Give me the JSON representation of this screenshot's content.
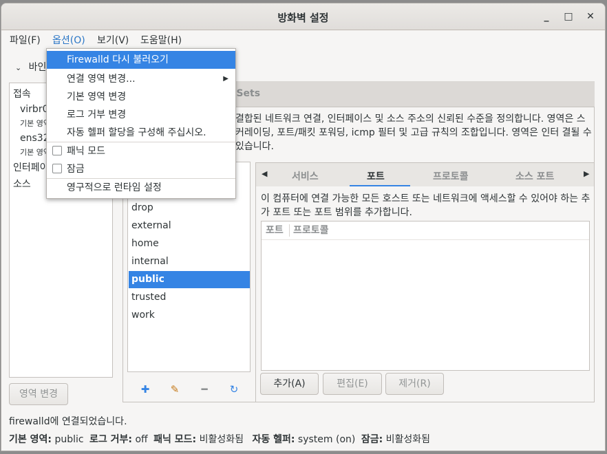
{
  "window": {
    "title": "방화벽 설정",
    "minimize": "_",
    "maximize": "□",
    "close": "✕"
  },
  "menubar": [
    "파일(F)",
    "옵션(O)",
    "보기(V)",
    "도움말(H)"
  ],
  "binding_label": "바인",
  "left_list": {
    "connections_header": "접속",
    "connections": [
      {
        "name": "virbr0",
        "zone": "기본 영역"
      },
      {
        "name": "ens32",
        "zone": "기본 영역"
      }
    ],
    "interfaces_header": "인터페이",
    "sources_header": "소스"
  },
  "change_zone_button": "영역 변경",
  "top_tab_partial": "IPSets",
  "zone_description": "결합된 네트워크 연결, 인터페이스 및 소스 주소의 신뢰된 수준을 정의합니다. 영역은 스커레이딩, 포트/패킷 포워딩, icmp 필터 및 고급 규칙의 조합입니다. 영역은 인터 결될 수 있습니다.",
  "zones": [
    "drop",
    "external",
    "home",
    "internal",
    "public",
    "trusted",
    "work"
  ],
  "selected_zone": "public",
  "subtabs": [
    "서비스",
    "포트",
    "프로토콜",
    "소스 포트"
  ],
  "active_subtab": "포트",
  "ports": {
    "description": "이 컴퓨터에 연결 가능한 모든 호스트 또는 네트워크에 액세스할 수 있어야 하는 추가 포트 또는 포트 범위를 추가합니다.",
    "columns": [
      "포트",
      "프로토콜"
    ],
    "add_button": "추가(A)",
    "edit_button": "편집(E)",
    "remove_button": "제거(R)"
  },
  "status": {
    "connection": "firewalld에 연결되었습니다.",
    "default_zone_label": "기본 영역:",
    "default_zone_value": "public",
    "log_denied_label": "로그 거부:",
    "log_denied_value": "off",
    "panic_label": "패닉 모드:",
    "panic_value": "비활성화됨",
    "helper_label": "자동 헬퍼:",
    "helper_value": "system (on)",
    "lockdown_label": "잠금:",
    "lockdown_value": "비활성화됨"
  },
  "options_menu": {
    "items": [
      {
        "label": "Firewalld 다시 불러오기",
        "highlighted": true
      },
      {
        "label": "연결 영역 변경...",
        "submenu": true
      },
      {
        "label": "기본 영역 변경"
      },
      {
        "label": "로그 거부 변경"
      },
      {
        "label": "자동 헬퍼 할당을 구성해 주십시오."
      },
      {
        "label": "패닉 모드",
        "checkbox": true,
        "checked": false
      },
      {
        "label": "잠금",
        "checkbox": true,
        "checked": false
      },
      {
        "label": "영구적으로 런타임 설정"
      }
    ]
  },
  "colors": {
    "accent": "#3584e4",
    "window_bg": "#f6f5f4"
  }
}
